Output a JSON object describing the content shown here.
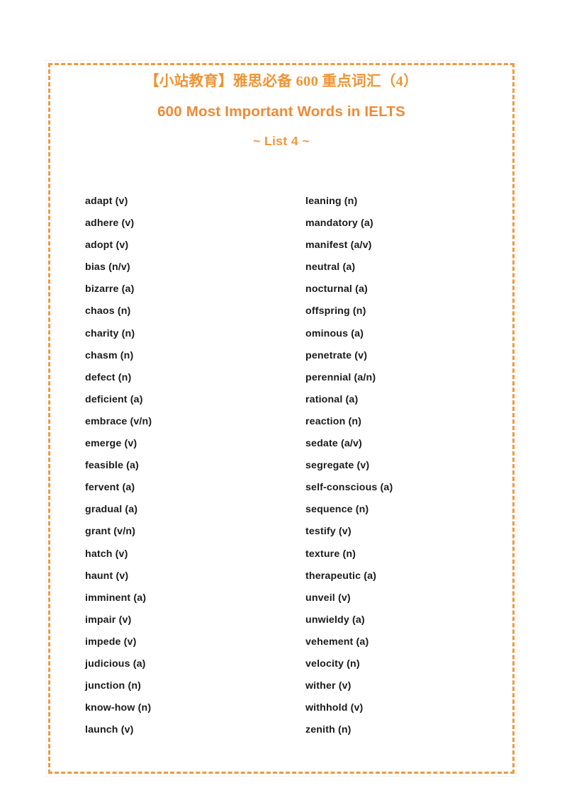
{
  "document": {
    "heading": {
      "title_cn": "【小站教育】雅思必备 600 重点词汇（4）",
      "title_en": "600 Most Important Words in IELTS",
      "list_label": "~ List 4 ~"
    },
    "accent_color": "#ee9434",
    "border_color": "#eb9a41",
    "text_color": "#1a1a1a",
    "columns": [
      {
        "name": "left-column",
        "words": [
          "adapt (v)",
          "adhere (v)",
          "adopt (v)",
          "bias (n/v)",
          "bizarre (a)",
          "chaos (n)",
          "charity (n)",
          "chasm (n)",
          "defect (n)",
          "deficient (a)",
          "embrace (v/n)",
          "emerge (v)",
          "feasible (a)",
          "fervent (a)",
          "gradual (a)",
          "grant (v/n)",
          "hatch (v)",
          "haunt (v)",
          "imminent (a)",
          "impair (v)",
          "impede (v)",
          "judicious (a)",
          "junction (n)",
          "know-how (n)",
          "launch (v)"
        ]
      },
      {
        "name": "right-column",
        "words": [
          "leaning (n)",
          "mandatory (a)",
          "manifest (a/v)",
          "neutral (a)",
          "nocturnal (a)",
          "offspring (n)",
          "ominous (a)",
          "penetrate (v)",
          "perennial (a/n)",
          "rational (a)",
          "reaction (n)",
          "sedate (a/v)",
          "segregate (v)",
          "self-conscious (a)",
          "sequence (n)",
          "testify (v)",
          "texture (n)",
          "therapeutic (a)",
          "unveil (v)",
          "unwieldy (a)",
          "vehement (a)",
          "velocity (n)",
          "wither (v)",
          "withhold (v)",
          "zenith (n)"
        ]
      }
    ]
  }
}
